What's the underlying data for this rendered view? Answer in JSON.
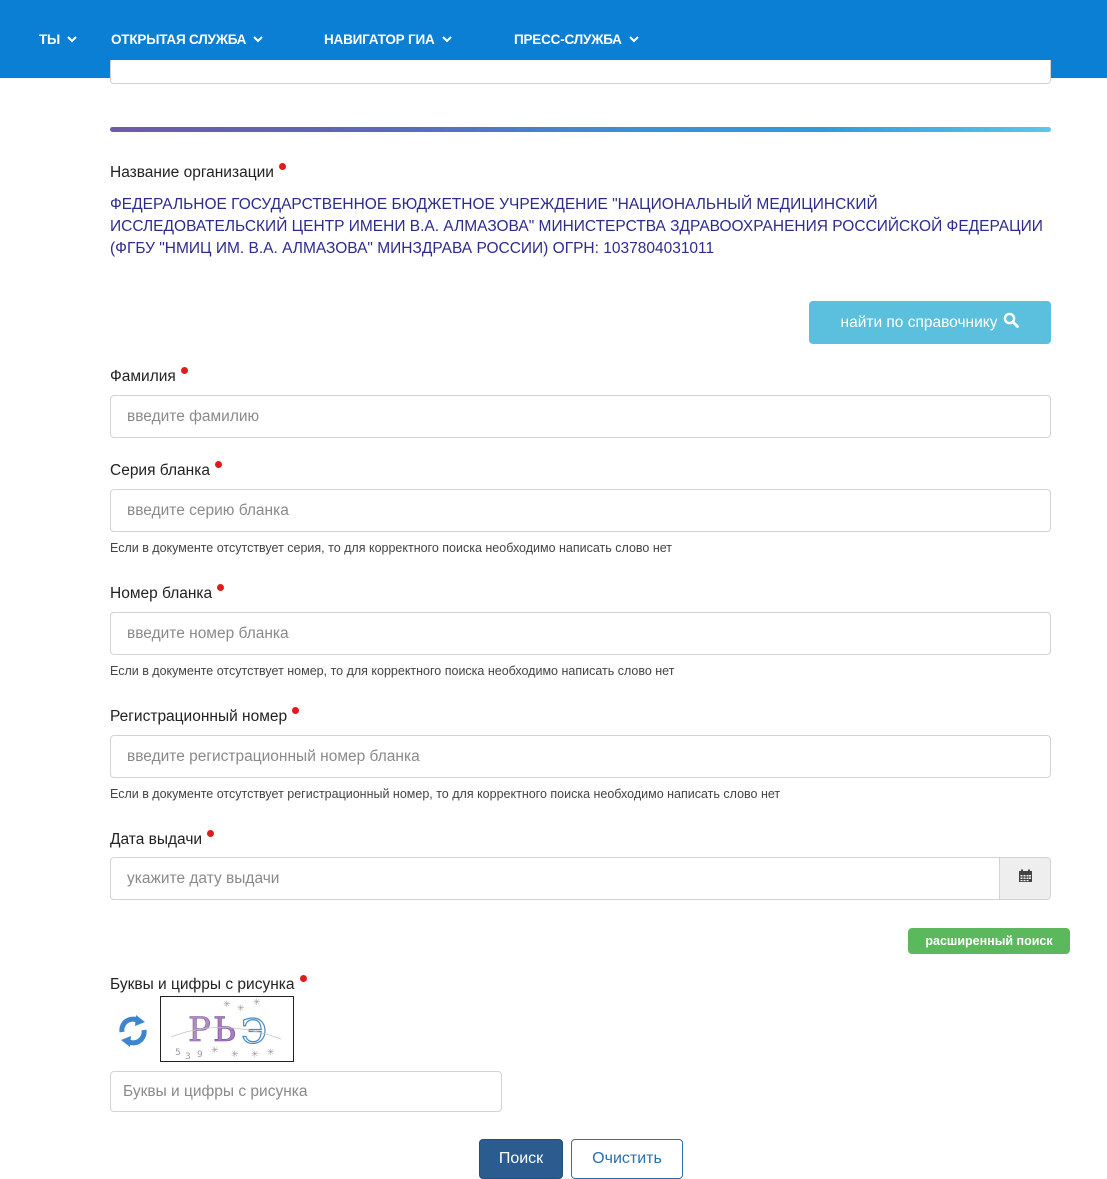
{
  "nav": {
    "items": [
      {
        "label": "ТЫ"
      },
      {
        "label": "ОТКРЫТАЯ СЛУЖБА"
      },
      {
        "label": "НАВИГАТОР ГИА"
      },
      {
        "label": "ПРЕСС-СЛУЖБА"
      }
    ],
    "bg_color": "#0a7fd4"
  },
  "form": {
    "org": {
      "label": "Название организации",
      "value": "ФЕДЕРАЛЬНОЕ ГОСУДАРСТВЕННОЕ БЮДЖЕТНОЕ УЧРЕЖДЕНИЕ \"НАЦИОНАЛЬНЫЙ МЕДИЦИНСКИЙ ИССЛЕДОВАТЕЛЬСКИЙ ЦЕНТР ИМЕНИ В.А. АЛМАЗОВА\" МИНИСТЕРСТВА ЗДРАВООХРАНЕНИЯ РОССИЙСКОЙ ФЕДЕРАЦИИ (ФГБУ \"НМИЦ ИМ. В.А. АЛМАЗОВА\" МИНЗДРАВА РОССИИ) ОГРН: 1037804031011",
      "lookup_button": "найти по справочнику"
    },
    "surname": {
      "label": "Фамилия",
      "placeholder": "введите фамилию"
    },
    "series": {
      "label": "Серия бланка",
      "placeholder": "введите серию бланка",
      "hint": "Если в документе отсутствует серия, то для корректного поиска необходимо написать слово нет"
    },
    "number": {
      "label": "Номер бланка",
      "placeholder": "введите номер бланка",
      "hint": "Если в документе отсутствует номер, то для корректного поиска необходимо написать слово нет"
    },
    "reg_number": {
      "label": "Регистрационный номер",
      "placeholder": "введите регистрационный номер бланка",
      "hint": "Если в документе отсутствует регистрационный номер, то для корректного поиска необходимо написать слово нет"
    },
    "issue_date": {
      "label": "Дата выдачи",
      "placeholder": "укажите дату выдачи"
    },
    "advanced_search": "расширенный поиск",
    "captcha": {
      "label": "Буквы и цифры с рисунка",
      "placeholder": "Буквы и цифры с рисунка",
      "image_text": "РЬЭ"
    },
    "search_button": "Поиск",
    "clear_button": "Очистить"
  },
  "icons": {
    "nav_chevron": "chevron-down-icon",
    "lookup": "search-icon",
    "date": "calendar-icon",
    "captcha_refresh": "refresh-icon"
  },
  "colors": {
    "required": "#e01b1b",
    "org_text": "#2c2c8c",
    "lookup_button": "#5bc0de",
    "advanced_badge": "#5cb85c",
    "search_button": "#2a5c8f"
  }
}
